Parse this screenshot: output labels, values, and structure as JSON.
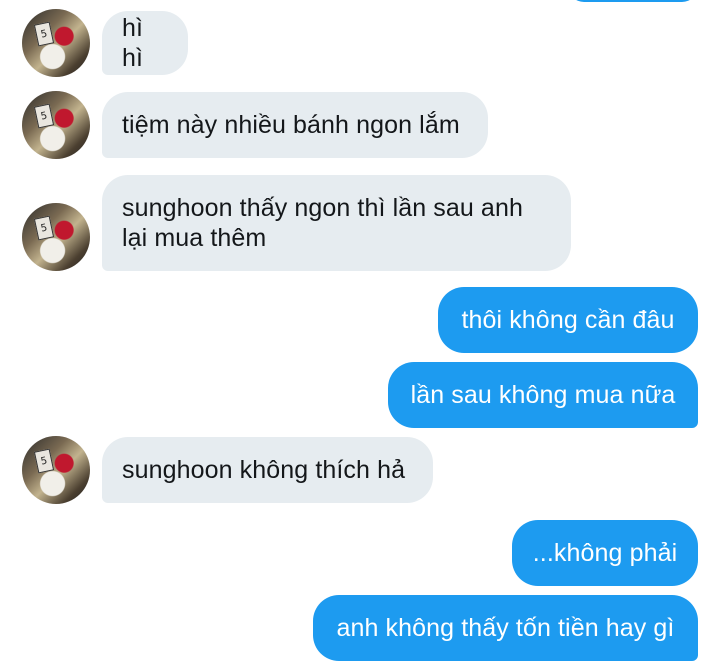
{
  "avatar_sign_text": "5",
  "messages": [
    {
      "from": "them",
      "text": "hì hì"
    },
    {
      "from": "them",
      "text": "tiệm này nhiều bánh ngon lắm"
    },
    {
      "from": "them",
      "line1": "sunghoon thấy ngon thì lần sau anh",
      "line2": "lại mua thêm"
    },
    {
      "from": "me",
      "text": "thôi không cần đâu"
    },
    {
      "from": "me",
      "text": "lần sau không mua nữa"
    },
    {
      "from": "them",
      "text": "sunghoon không thích hả"
    },
    {
      "from": "me",
      "text": "...không phải"
    },
    {
      "from": "me",
      "text": "anh không thấy tốn tiền hay gì"
    }
  ],
  "colors": {
    "incoming_bubble": "#e6ecf0",
    "outgoing_bubble": "#1d9bf0",
    "incoming_text": "#14171a",
    "outgoing_text": "#ffffff"
  }
}
